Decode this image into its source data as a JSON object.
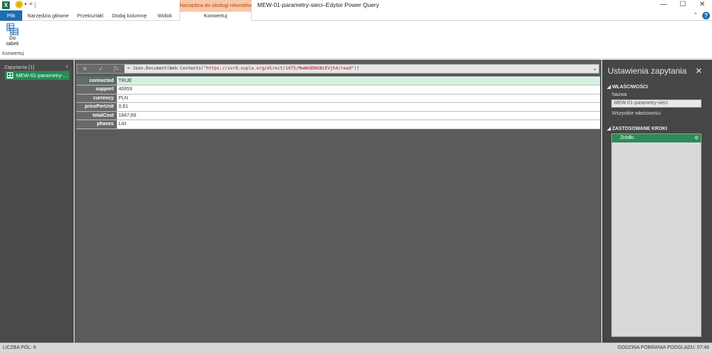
{
  "titlebar": {
    "app_icon": "excel-icon",
    "contextual_group": "Narzędzia do obsługi rekordów",
    "window_title": "MEW-01-parametry-sieci–Edytor Power Query",
    "controls": {
      "minimize": "—",
      "maximize": "☐",
      "close": "✕"
    }
  },
  "ribbon_tabs": {
    "file": "Plik",
    "home": "Narzędzia główne",
    "transform": "Przekształć",
    "add_column": "Dodaj kolumnę",
    "view": "Widok",
    "convert": "Konwertuj",
    "help": "?",
    "collapse": "⌃"
  },
  "ribbon": {
    "to_table_label_1": "Do",
    "to_table_label_2": "tabeli",
    "group_label": "Konwertuj"
  },
  "queries_pane": {
    "header": "Zapytania [1]",
    "collapse": "‹",
    "items": [
      {
        "label": "MEW-01-parametry-..."
      }
    ]
  },
  "formula_bar": {
    "cancel": "✕",
    "confirm": "✓",
    "fx": "fx",
    "prefix": "= Json.Document(Web.Contents(",
    "url": "\"https://svr9.supla.org/direct/1075/MwWUQDNGNzEVjh4/read\"",
    "suffix": "))",
    "expand": "⌄"
  },
  "record": [
    {
      "key": "connected",
      "value": "TRUE",
      "selected": true
    },
    {
      "key": "support",
      "value": "40959"
    },
    {
      "key": "currency",
      "value": "PLN"
    },
    {
      "key": "pricePerUnit",
      "value": "0,61"
    },
    {
      "key": "totalCost",
      "value": "1847,69"
    },
    {
      "key": "phases",
      "value": "List"
    }
  ],
  "settings": {
    "title": "Ustawienia zapytania",
    "close": "✕",
    "properties_header": "◢ WŁAŚCIWOŚCI",
    "name_label": "Nazwa",
    "name_value": "MEW-01-parametry-sieci",
    "all_properties": "Wszystkie właściwości",
    "steps_header": "◢ ZASTOSOWANE KROKI",
    "steps": [
      {
        "label": "Źródło",
        "gear": "✲"
      }
    ]
  },
  "status": {
    "left": "LICZBA PÓL: 6",
    "right": "GODZINA POBRANIA PODGLĄDU: 07:46"
  },
  "colors": {
    "file_tab": "#1f6cb0",
    "contextual": "#f7c8a6",
    "query_selected": "#1e8e55",
    "step_selected": "#2e8b57"
  }
}
